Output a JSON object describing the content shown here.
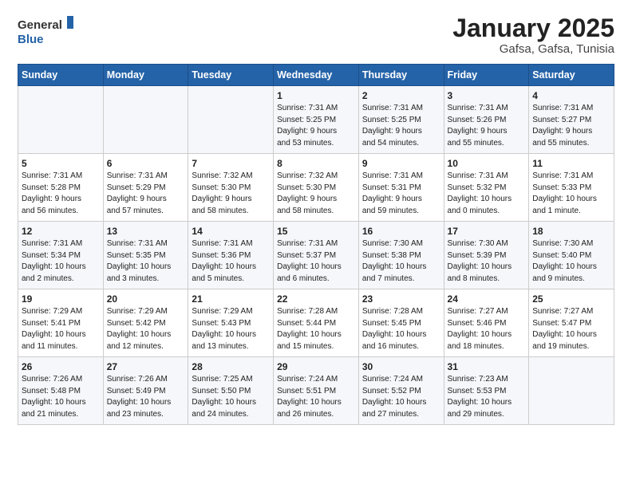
{
  "logo": {
    "general": "General",
    "blue": "Blue"
  },
  "title": "January 2025",
  "subtitle": "Gafsa, Gafsa, Tunisia",
  "days_of_week": [
    "Sunday",
    "Monday",
    "Tuesday",
    "Wednesday",
    "Thursday",
    "Friday",
    "Saturday"
  ],
  "weeks": [
    [
      {
        "day": null,
        "info": null
      },
      {
        "day": null,
        "info": null
      },
      {
        "day": null,
        "info": null
      },
      {
        "day": "1",
        "info": "Sunrise: 7:31 AM\nSunset: 5:25 PM\nDaylight: 9 hours\nand 53 minutes."
      },
      {
        "day": "2",
        "info": "Sunrise: 7:31 AM\nSunset: 5:25 PM\nDaylight: 9 hours\nand 54 minutes."
      },
      {
        "day": "3",
        "info": "Sunrise: 7:31 AM\nSunset: 5:26 PM\nDaylight: 9 hours\nand 55 minutes."
      },
      {
        "day": "4",
        "info": "Sunrise: 7:31 AM\nSunset: 5:27 PM\nDaylight: 9 hours\nand 55 minutes."
      }
    ],
    [
      {
        "day": "5",
        "info": "Sunrise: 7:31 AM\nSunset: 5:28 PM\nDaylight: 9 hours\nand 56 minutes."
      },
      {
        "day": "6",
        "info": "Sunrise: 7:31 AM\nSunset: 5:29 PM\nDaylight: 9 hours\nand 57 minutes."
      },
      {
        "day": "7",
        "info": "Sunrise: 7:32 AM\nSunset: 5:30 PM\nDaylight: 9 hours\nand 58 minutes."
      },
      {
        "day": "8",
        "info": "Sunrise: 7:32 AM\nSunset: 5:30 PM\nDaylight: 9 hours\nand 58 minutes."
      },
      {
        "day": "9",
        "info": "Sunrise: 7:31 AM\nSunset: 5:31 PM\nDaylight: 9 hours\nand 59 minutes."
      },
      {
        "day": "10",
        "info": "Sunrise: 7:31 AM\nSunset: 5:32 PM\nDaylight: 10 hours\nand 0 minutes."
      },
      {
        "day": "11",
        "info": "Sunrise: 7:31 AM\nSunset: 5:33 PM\nDaylight: 10 hours\nand 1 minute."
      }
    ],
    [
      {
        "day": "12",
        "info": "Sunrise: 7:31 AM\nSunset: 5:34 PM\nDaylight: 10 hours\nand 2 minutes."
      },
      {
        "day": "13",
        "info": "Sunrise: 7:31 AM\nSunset: 5:35 PM\nDaylight: 10 hours\nand 3 minutes."
      },
      {
        "day": "14",
        "info": "Sunrise: 7:31 AM\nSunset: 5:36 PM\nDaylight: 10 hours\nand 5 minutes."
      },
      {
        "day": "15",
        "info": "Sunrise: 7:31 AM\nSunset: 5:37 PM\nDaylight: 10 hours\nand 6 minutes."
      },
      {
        "day": "16",
        "info": "Sunrise: 7:30 AM\nSunset: 5:38 PM\nDaylight: 10 hours\nand 7 minutes."
      },
      {
        "day": "17",
        "info": "Sunrise: 7:30 AM\nSunset: 5:39 PM\nDaylight: 10 hours\nand 8 minutes."
      },
      {
        "day": "18",
        "info": "Sunrise: 7:30 AM\nSunset: 5:40 PM\nDaylight: 10 hours\nand 9 minutes."
      }
    ],
    [
      {
        "day": "19",
        "info": "Sunrise: 7:29 AM\nSunset: 5:41 PM\nDaylight: 10 hours\nand 11 minutes."
      },
      {
        "day": "20",
        "info": "Sunrise: 7:29 AM\nSunset: 5:42 PM\nDaylight: 10 hours\nand 12 minutes."
      },
      {
        "day": "21",
        "info": "Sunrise: 7:29 AM\nSunset: 5:43 PM\nDaylight: 10 hours\nand 13 minutes."
      },
      {
        "day": "22",
        "info": "Sunrise: 7:28 AM\nSunset: 5:44 PM\nDaylight: 10 hours\nand 15 minutes."
      },
      {
        "day": "23",
        "info": "Sunrise: 7:28 AM\nSunset: 5:45 PM\nDaylight: 10 hours\nand 16 minutes."
      },
      {
        "day": "24",
        "info": "Sunrise: 7:27 AM\nSunset: 5:46 PM\nDaylight: 10 hours\nand 18 minutes."
      },
      {
        "day": "25",
        "info": "Sunrise: 7:27 AM\nSunset: 5:47 PM\nDaylight: 10 hours\nand 19 minutes."
      }
    ],
    [
      {
        "day": "26",
        "info": "Sunrise: 7:26 AM\nSunset: 5:48 PM\nDaylight: 10 hours\nand 21 minutes."
      },
      {
        "day": "27",
        "info": "Sunrise: 7:26 AM\nSunset: 5:49 PM\nDaylight: 10 hours\nand 23 minutes."
      },
      {
        "day": "28",
        "info": "Sunrise: 7:25 AM\nSunset: 5:50 PM\nDaylight: 10 hours\nand 24 minutes."
      },
      {
        "day": "29",
        "info": "Sunrise: 7:24 AM\nSunset: 5:51 PM\nDaylight: 10 hours\nand 26 minutes."
      },
      {
        "day": "30",
        "info": "Sunrise: 7:24 AM\nSunset: 5:52 PM\nDaylight: 10 hours\nand 27 minutes."
      },
      {
        "day": "31",
        "info": "Sunrise: 7:23 AM\nSunset: 5:53 PM\nDaylight: 10 hours\nand 29 minutes."
      },
      {
        "day": null,
        "info": null
      }
    ]
  ]
}
